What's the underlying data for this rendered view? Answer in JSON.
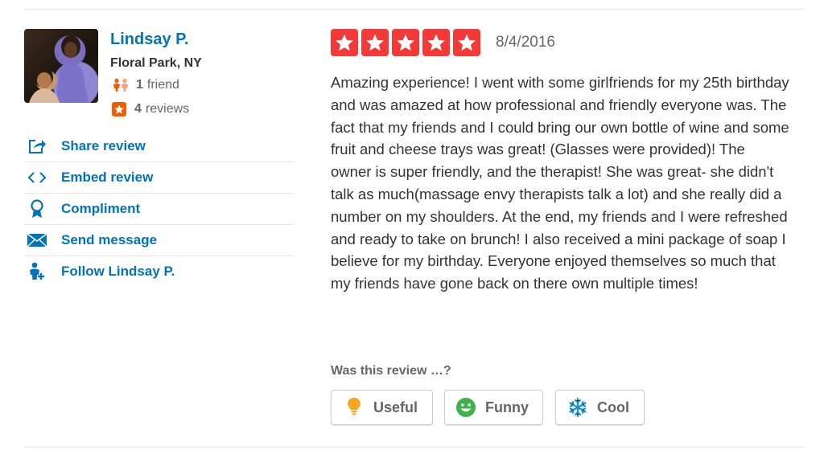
{
  "user": {
    "name": "Lindsay P.",
    "location": "Floral Park, NY",
    "friends_count": "1",
    "friends_label": "friend",
    "reviews_count": "4",
    "reviews_label": "reviews"
  },
  "actions": [
    {
      "label": "Share review",
      "icon": "share-icon"
    },
    {
      "label": "Embed review",
      "icon": "embed-icon"
    },
    {
      "label": "Compliment",
      "icon": "award-ribbon-icon"
    },
    {
      "label": "Send message",
      "icon": "envelope-icon"
    },
    {
      "label": "Follow Lindsay P.",
      "icon": "follow-user-icon"
    }
  ],
  "review": {
    "rating": 5,
    "date": "8/4/2016",
    "text": "Amazing experience! I went with some girlfriends for my 25th birthday and was amazed at how professional and friendly everyone was. The fact that my friends and I could bring our own bottle of wine and some fruit and cheese trays was great! (Glasses were provided)! The owner is super friendly, and the therapist! She was great- she didn't talk as much(massage envy therapists talk a lot) and she really did a number on my shoulders. At the end, my friends and I were refreshed and ready to take on brunch! I also received a mini package of soap I believe for my birthday. Everyone enjoyed themselves so much that my friends have gone back on there own multiple times!"
  },
  "votes": {
    "prompt": "Was this review …?",
    "useful": "Useful",
    "funny": "Funny",
    "cool": "Cool"
  },
  "colors": {
    "link_blue": "#0073bb",
    "star_red": "#f43939",
    "orange": "#f15c00",
    "funny_green": "#3db34a",
    "useful_yellow": "#f5a623",
    "cool_blue": "#1a8fd6"
  }
}
